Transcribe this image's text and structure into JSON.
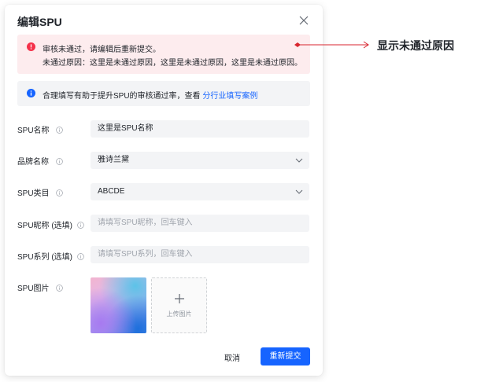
{
  "dialog": {
    "title": "编辑SPU"
  },
  "alert_error": {
    "line1": "审核未通过，请编辑后重新提交。",
    "line2": "未通过原因：这里是未通过原因，这里是未通过原因，这里是未通过原因。"
  },
  "alert_info": {
    "text": "合理填写有助于提升SPU的审核通过率，查看",
    "link": "分行业填写案例"
  },
  "form": {
    "spu_name": {
      "label": "SPU名称",
      "value": "这里是SPU名称"
    },
    "brand": {
      "label": "品牌名称",
      "value": "雅诗兰黛"
    },
    "category": {
      "label": "SPU类目",
      "value": "ABCDE"
    },
    "nickname": {
      "label": "SPU昵称 (选填)",
      "placeholder": "请填写SPU昵称，回车键入"
    },
    "series": {
      "label": "SPU系列 (选填)",
      "placeholder": "请填写SPU系列，回车键入"
    },
    "images": {
      "label": "SPU图片",
      "upload_text": "上传图片"
    }
  },
  "footer": {
    "cancel": "取消",
    "submit": "重新提交"
  },
  "annotation": {
    "text": "显示未通过原因"
  },
  "colors": {
    "primary": "#1664ff",
    "error": "#f5314a",
    "error_bg": "#fdecee",
    "info": "#1664ff",
    "annotation": "#d8262f"
  },
  "icons": [
    "close-icon",
    "error-circle-icon",
    "info-circle-icon",
    "chevron-down-icon",
    "plus-icon"
  ]
}
